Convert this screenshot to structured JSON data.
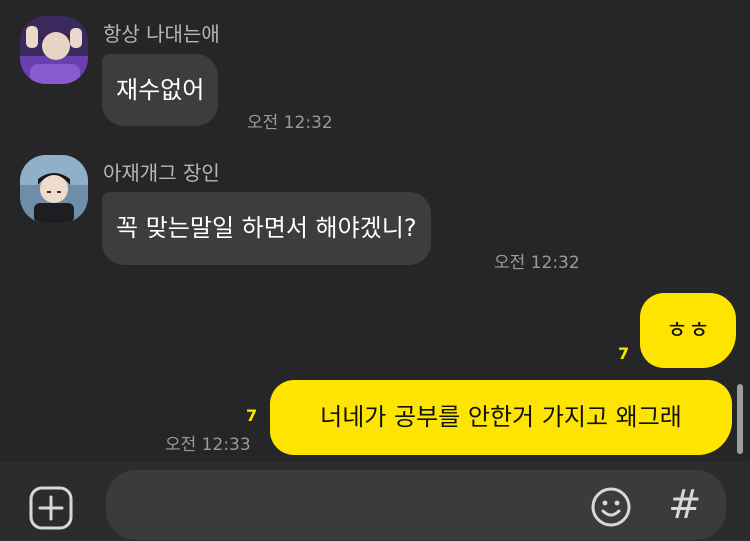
{
  "messages": [
    {
      "sender": "항상 나대는애",
      "avatar_icon": "profile-photo-purple",
      "text": "재수없어",
      "time": "오전 12:32"
    },
    {
      "sender": "아재개그 장인",
      "avatar_icon": "profile-photo-portrait",
      "text": "꼭 맞는말일 하면서 해야겠니?",
      "time": "오전 12:32"
    }
  ],
  "my_messages": [
    {
      "text": "ㅎㅎ",
      "unread": "7"
    },
    {
      "text": "너네가 공부를 안한거 가지고 왜그래",
      "unread": "7",
      "time": "오전 12:33"
    }
  ],
  "composer": {
    "plus_icon": "plus-icon",
    "emoji_icon": "emoji-icon",
    "hash_label": "#"
  },
  "colors": {
    "background": "#262628",
    "incoming_bubble": "#3d3d40",
    "outgoing_bubble": "#fee500",
    "unread": "#f7e600"
  }
}
